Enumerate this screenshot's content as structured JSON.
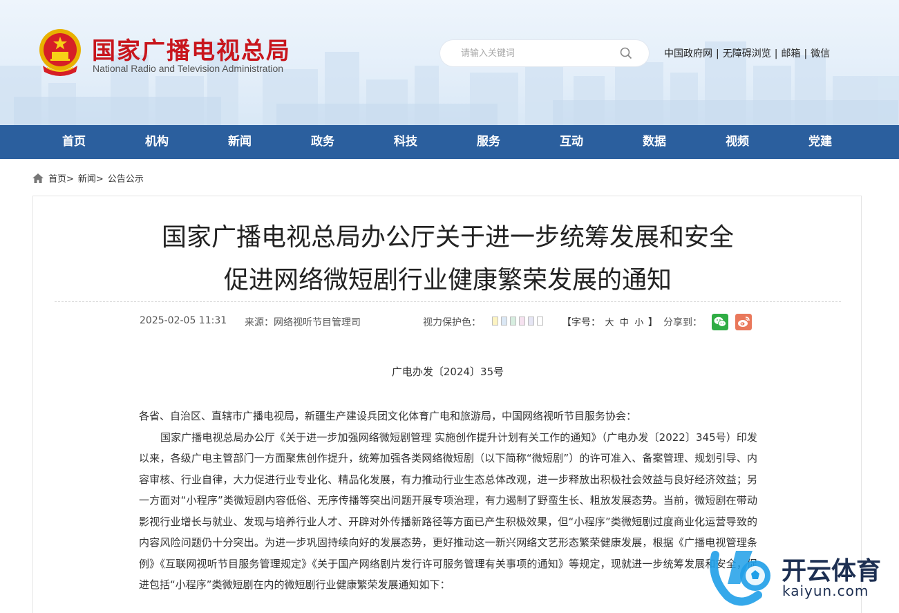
{
  "header": {
    "site_name_cn": "国家广播电视总局",
    "site_name_en": "National Radio and Television Administration",
    "search_placeholder": "请输入关键词",
    "top_links": [
      "中国政府网",
      "无障碍浏览",
      "邮箱",
      "微信"
    ]
  },
  "nav": {
    "items": [
      "首页",
      "机构",
      "新闻",
      "政务",
      "科技",
      "服务",
      "互动",
      "数据",
      "视频",
      "党建"
    ]
  },
  "breadcrumb": {
    "items": [
      "首页>",
      "新闻>",
      "公告公示"
    ]
  },
  "article": {
    "title_line1": "国家广播电视总局办公厅关于进一步统筹发展和安全",
    "title_line2": "促进网络微短剧行业健康繁荣发展的通知",
    "datetime": "2025-02-05 11:31",
    "source": "来源：网络视听节目管理司",
    "eye_care_label": "视力保护色：",
    "eye_care_colors": [
      "#fdf4c2",
      "#e8f0f8",
      "#d7eee0",
      "#f6e2f0",
      "#e6e6f5",
      "#ffffff"
    ],
    "font_size_label_open": "【字号：",
    "font_sizes": [
      "大",
      "中",
      "小"
    ],
    "font_size_label_close": "】",
    "share_label": "分享到：",
    "share_colors": {
      "wechat": "#2fad44",
      "weibo": "#e9785b"
    },
    "doc_number": "广电办发〔2024〕35号",
    "salutation": "各省、自治区、直辖市广播电视局，新疆生产建设兵团文化体育广电和旅游局，中国网络视听节目服务协会：",
    "paragraph1": "国家广播电视总局办公厅《关于进一步加强网络微短剧管理 实施创作提升计划有关工作的通知》（广电办发〔2022〕345号）印发以来，各级广电主管部门一方面聚焦创作提升，统筹加强各类网络微短剧（以下简称“微短剧”）的许可准入、备案管理、规划引导、内容审核、行业自律，大力促进行业专业化、精品化发展，有力推动行业生态总体改观，进一步释放出积极社会效益与良好经济效益；另一方面对“小程序”类微短剧内容低俗、无序传播等突出问题开展专项治理，有力遏制了野蛮生长、粗放发展态势。当前，微短剧在带动影视行业增长与就业、发现与培养行业人才、开辟对外传播新路径等方面已产生积极效果，但“小程序”类微短剧过度商业化运营导致的内容风险问题仍十分突出。为进一步巩固持续向好的发展态势，更好推动这一新兴网络文艺形态繁荣健康发展，根据《广播电视管理条例》《互联网视听节目服务管理规定》《关于国产网络剧片发行许可服务管理有关事项的通知》等规定，现就进一步统筹发展和安全，促进包括“小程序”类微短剧在内的微短剧行业健康繁荣发展通知如下："
  },
  "watermark": {
    "brand_cn": "开云体育",
    "brand_en": "kaiyun.com"
  }
}
